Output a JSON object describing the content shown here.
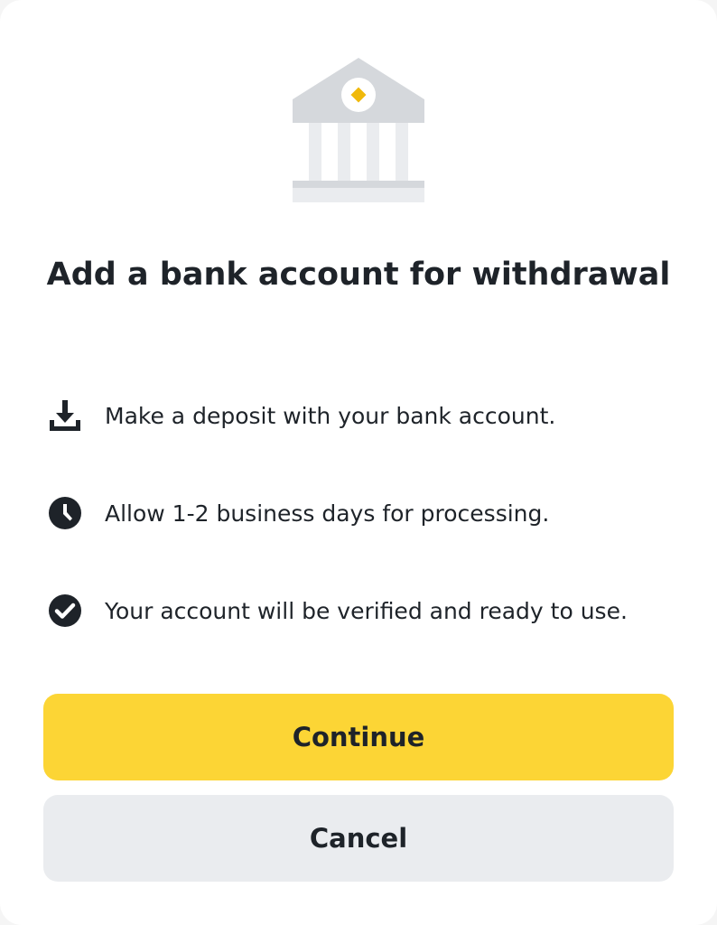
{
  "dialog": {
    "title": "Add a bank account for withdrawal",
    "hero_icon": "bank-icon"
  },
  "steps": [
    {
      "icon": "download-icon",
      "text": "Make a deposit with your bank account."
    },
    {
      "icon": "clock-icon",
      "text": "Allow 1-2 business days for processing."
    },
    {
      "icon": "check-circle-icon",
      "text": "Your account will be verified and ready to use."
    }
  ],
  "buttons": {
    "continue_label": "Continue",
    "cancel_label": "Cancel"
  },
  "colors": {
    "primary": "#fcd535",
    "secondary": "#eaecef",
    "text": "#1e2329",
    "hero_gray": "#d5d8dc",
    "hero_light": "#eaecef",
    "accent": "#f0b90b"
  }
}
